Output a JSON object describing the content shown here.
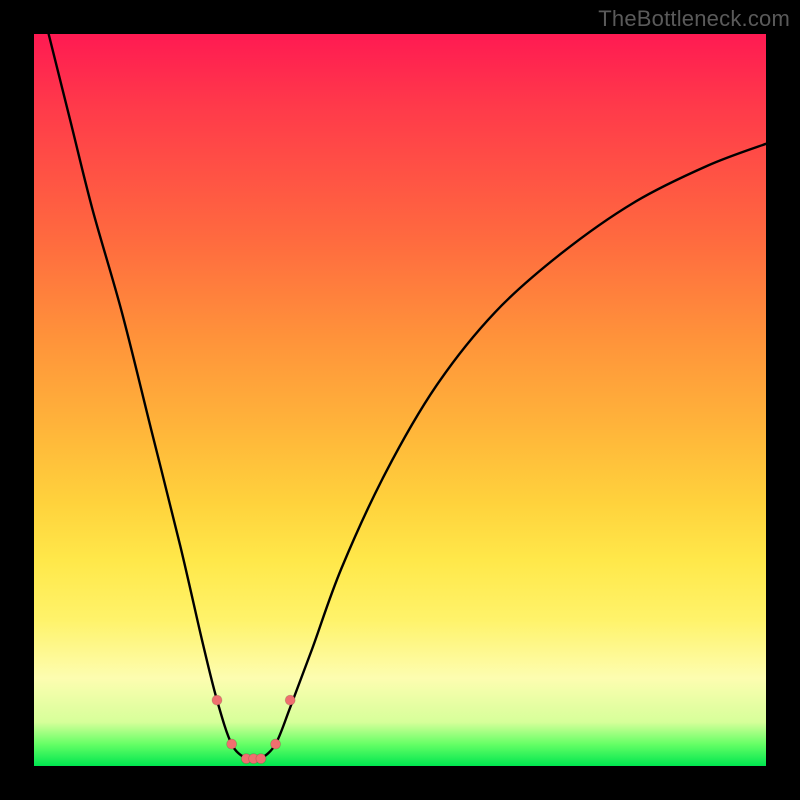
{
  "watermark": "TheBottleneck.com",
  "chart_data": {
    "type": "line",
    "title": "",
    "xlabel": "",
    "ylabel": "",
    "xlim": [
      0,
      100
    ],
    "ylim": [
      0,
      100
    ],
    "grid": false,
    "series": [
      {
        "name": "bottleneck-curve",
        "x": [
          2,
          5,
          8,
          12,
          16,
          20,
          23,
          25,
          27,
          29,
          30,
          31,
          33,
          35,
          38,
          42,
          48,
          55,
          63,
          72,
          82,
          92,
          100
        ],
        "values": [
          100,
          88,
          76,
          62,
          46,
          30,
          17,
          9,
          3,
          1,
          1,
          1,
          3,
          8,
          16,
          27,
          40,
          52,
          62,
          70,
          77,
          82,
          85
        ]
      }
    ],
    "markers": {
      "name": "highlight-dots",
      "color": "#ef6f6f",
      "x": [
        25.0,
        27.0,
        29.0,
        30.0,
        31.0,
        33.0,
        35.0
      ],
      "values": [
        9.0,
        3.0,
        1.0,
        1.0,
        1.0,
        3.0,
        9.0
      ]
    },
    "background_gradient": {
      "top": "#ff1a52",
      "upper_mid": "#ff943a",
      "mid": "#ffe84a",
      "lower_mid": "#fdfdb0",
      "bottom": "#00e650"
    },
    "curve_color": "#000000",
    "marker_radius": 5
  }
}
